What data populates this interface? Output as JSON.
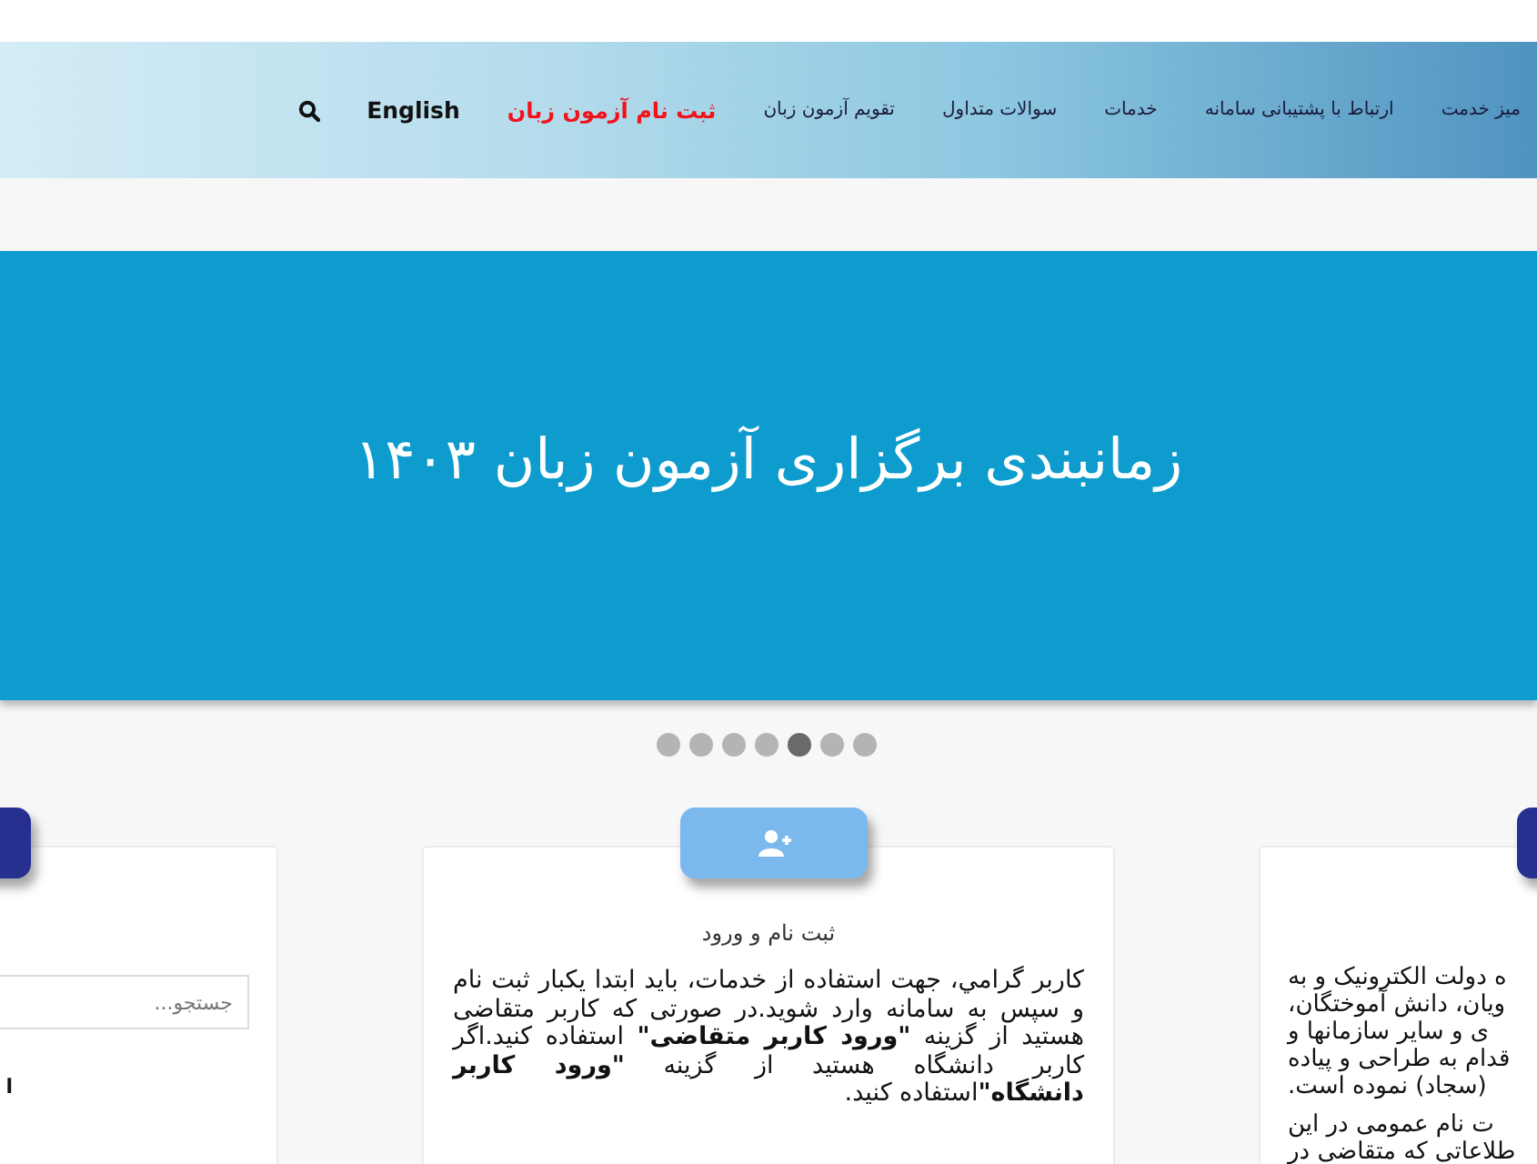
{
  "nav": {
    "items": [
      {
        "label": "میز خدمت",
        "kind": "link"
      },
      {
        "label": "ارتباط با پشتیبانی سامانه",
        "kind": "link"
      },
      {
        "label": "خدمات",
        "kind": "link"
      },
      {
        "label": "سوالات متداول",
        "kind": "link"
      },
      {
        "label": "تقویم آزمون زبان",
        "kind": "link"
      },
      {
        "label": "ثبت نام آزمون زبان",
        "kind": "highlight"
      },
      {
        "label": "English",
        "kind": "language"
      }
    ]
  },
  "banner": {
    "title": "زمانبندی برگزاری آزمون زبان ۱۴۰۳"
  },
  "slider": {
    "dots": [
      {
        "selected": false
      },
      {
        "selected": false
      },
      {
        "selected": false
      },
      {
        "selected": false
      },
      {
        "selected": true
      },
      {
        "selected": false
      },
      {
        "selected": false
      }
    ]
  },
  "cards": [
    {
      "search": {
        "placeholder": "جستجو..."
      },
      "lines": [
        "ا"
      ]
    },
    {
      "title": "ثبت نام و ورود",
      "text": "کاربر گرامي، جهت استفاده از خدمات، باید ابتدا یکبار ثبت نام و سپس به سامانه وارد شوید.در صورتی که کاربر متقاضی هستید از گزینه **\"ورود کاربر متقاضی\"** استفاده کنید.اگر کاربر دانشگاه هستید از گزینه **\"ورود کاربر دانشگاه\"**استفاده کنید."
    },
    {
      "lines": [
        "ه دولت الکترونیک و به",
        "ویان، دانش آموختگان،",
        "ی و سایر سازمانها و",
        "قدام به طراحی و پیاده",
        "(سجاد) نموده است.",
        "ت نام عمومی در این",
        "طلاعاتی که متقاضی در"
      ]
    }
  ]
}
